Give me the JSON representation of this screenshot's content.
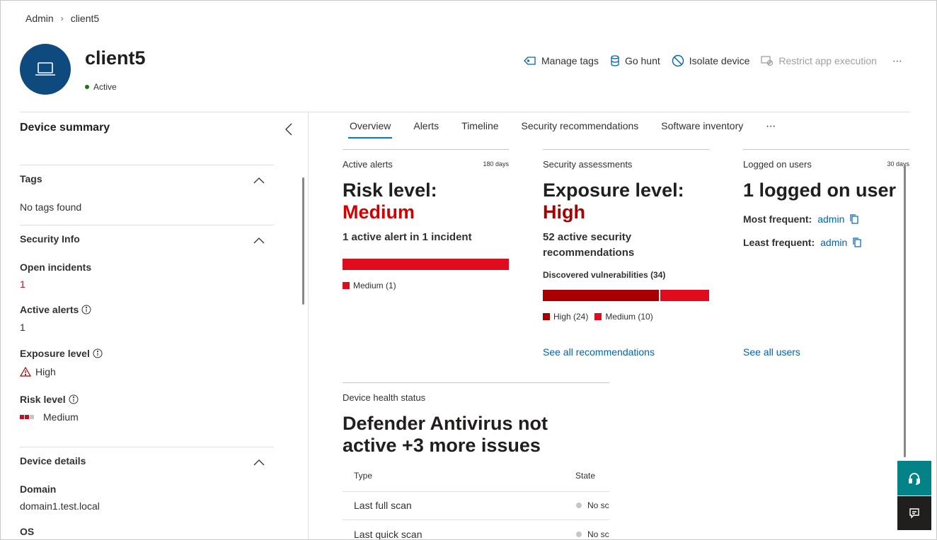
{
  "breadcrumb": {
    "root": "Admin",
    "current": "client5"
  },
  "device": {
    "name": "client5",
    "status": "Active"
  },
  "actions": {
    "manage_tags": "Manage tags",
    "go_hunt": "Go hunt",
    "isolate": "Isolate device",
    "restrict": "Restrict app execution",
    "more": "⋯"
  },
  "summary": {
    "title": "Device summary",
    "tags": {
      "heading": "Tags",
      "empty": "No tags found"
    },
    "security_info": {
      "heading": "Security Info",
      "open_incidents_label": "Open incidents",
      "open_incidents_value": "1",
      "active_alerts_label": "Active alerts",
      "active_alerts_value": "1",
      "exposure_label": "Exposure level",
      "exposure_value": "High",
      "risk_label": "Risk level",
      "risk_value": "Medium"
    },
    "device_details": {
      "heading": "Device details",
      "domain_label": "Domain",
      "domain_value": "domain1.test.local",
      "os_label": "OS"
    }
  },
  "tabs": [
    "Overview",
    "Alerts",
    "Timeline",
    "Security recommendations",
    "Software inventory"
  ],
  "tabs_more": "⋯",
  "active_alerts": {
    "title": "Active alerts",
    "days": "180 days",
    "risk_heading": "Risk level:",
    "risk_value": "Medium",
    "summary": "1 active alert in 1 incident",
    "legend_medium": "Medium (1)",
    "medium_count": 1
  },
  "security_assessments": {
    "title": "Security assessments",
    "exposure_heading": "Exposure level:",
    "exposure_value": "High",
    "summary_line1": "52 active security",
    "summary_line2": "recommendations",
    "vuln_title": "Discovered vulnerabilities (34)",
    "legend_high": "High (24)",
    "legend_medium": "Medium (10)",
    "high_count": 24,
    "medium_count": 10,
    "link": "See all recommendations"
  },
  "logged_users": {
    "title": "Logged on users",
    "days": "30 days",
    "heading": "1 logged on user",
    "most_label": "Most frequent:",
    "most_value": "admin",
    "least_label": "Least frequent:",
    "least_value": "admin",
    "link": "See all users"
  },
  "health": {
    "title": "Device health status",
    "line1": "Defender Antivirus not",
    "line2": "active +3 more issues",
    "col_type": "Type",
    "col_state": "State",
    "rows": [
      {
        "type": "Last full scan",
        "state": "No sc"
      },
      {
        "type": "Last quick scan",
        "state": "No sc"
      }
    ]
  },
  "colors": {
    "high": "#a80000",
    "medium": "#e00b1c",
    "accent": "#0078d4",
    "navy": "#0f4a7e"
  }
}
